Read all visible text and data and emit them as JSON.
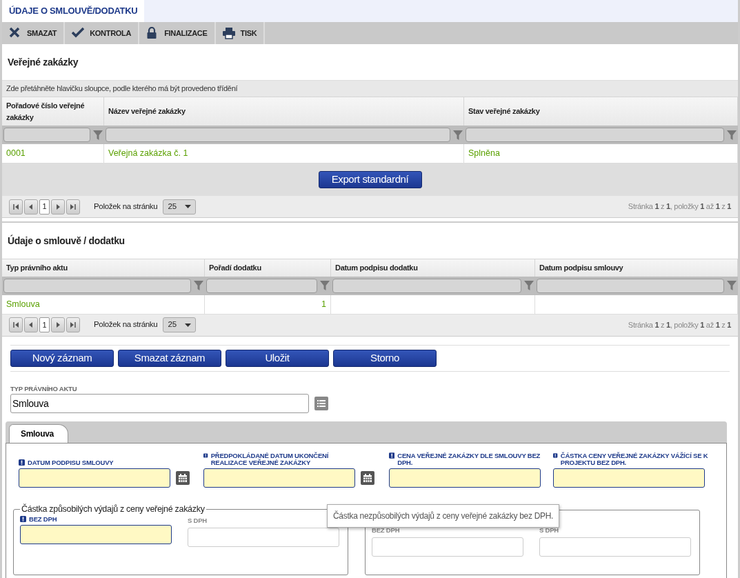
{
  "page_tabs": [
    {
      "label": "ÚDAJE O SMLOUVĚ/DODATKU",
      "selected": true
    }
  ],
  "toolbar": [
    {
      "kind": "delete",
      "label": "SMAZAT"
    },
    {
      "kind": "check",
      "label": "KONTROLA"
    },
    {
      "kind": "lock",
      "label": "FINALIZACE"
    },
    {
      "kind": "print",
      "label": "TISK"
    }
  ],
  "public_contracts": {
    "title": "Veřejné zakázky",
    "group_hint": "Zde přetáhněte hlavičku sloupce, podle kterého má být provedeno třídění",
    "columns": [
      "Pořadové číslo veřejné zakázky",
      "Název veřejné zakázky",
      "Stav veřejné zakázky"
    ],
    "rows": [
      [
        "0001",
        "Veřejná zakázka č. 1",
        "Splněna"
      ]
    ],
    "export_button": "Export standardní",
    "pager": {
      "page": "1",
      "per_page_label": "Položek na stránku",
      "per_page": "25",
      "status": "Stránka **1** z **1**, položky **1** až **1** z **1**"
    }
  },
  "contract_data": {
    "title": "Údaje o smlouvě / dodatku",
    "columns": [
      "Typ právního aktu",
      "Pořadí dodatku",
      "Datum podpisu dodatku",
      "Datum podpisu smlouvy"
    ],
    "rows": [
      [
        "Smlouva",
        "1",
        "",
        ""
      ]
    ],
    "pager": {
      "page": "1",
      "per_page_label": "Položek na stránku",
      "per_page": "25",
      "status": "Stránka **1** z **1**, položky **1** až **1** z **1**"
    }
  },
  "actions": [
    "Nový záznam",
    "Smazat záznam",
    "Uložit",
    "Storno"
  ],
  "legal_act_type": {
    "label": "TYP PRÁVNÍHO AKTU",
    "value": "Smlouva"
  },
  "form_tabs": [
    {
      "label": "Smlouva",
      "selected": true
    }
  ],
  "fields": [
    {
      "kind": "date",
      "label": "DATUM PODPISU SMLOUVY",
      "required": true
    },
    {
      "kind": "date",
      "label": "PŘEDPOKLÁDANÉ DATUM UKONČENÍ REALIZACE VEŘEJNÉ ZAKÁZKY",
      "required": true
    },
    {
      "kind": "text",
      "label": "CENA VEŘEJNÉ ZAKÁZKY DLE SMLOUVY BEZ DPH.",
      "required": true
    },
    {
      "kind": "text",
      "label": "ČÁSTKA CENY VEŘEJNÉ ZAKÁZKY VÁŽÍCÍ SE K PROJEKTU BEZ DPH.",
      "required": true
    }
  ],
  "fieldsets": [
    {
      "legend": "Částka způsobilých výdajů z ceny veřejné zakázky",
      "fields": [
        {
          "label": "BEZ DPH",
          "required": true
        },
        {
          "label": "S DPH",
          "required": false
        }
      ]
    },
    {
      "fields": [
        {
          "label": "BEZ DPH",
          "required": false
        },
        {
          "label": "S DPH",
          "required": false
        }
      ]
    }
  ],
  "tooltip": "Částka nezpůsobilých výdajů z ceny veřejné zakázky bez DPH."
}
